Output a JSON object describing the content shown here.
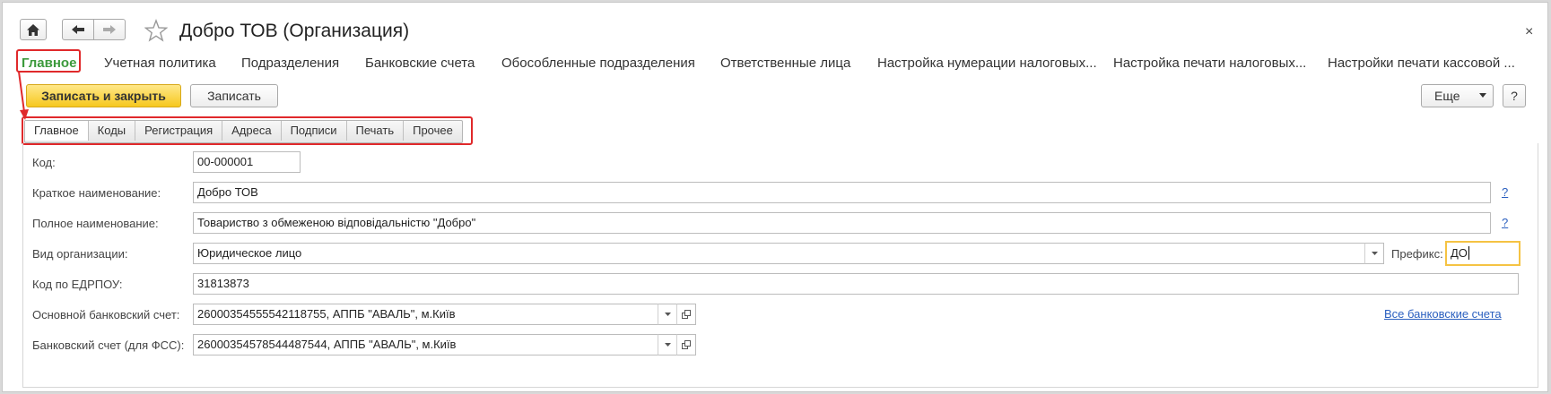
{
  "window": {
    "title": "Добро ТОВ (Организация)",
    "close_glyph": "×"
  },
  "sections": [
    {
      "label": "Главное",
      "active": true
    },
    {
      "label": "Учетная политика"
    },
    {
      "label": "Подразделения"
    },
    {
      "label": "Банковские счета"
    },
    {
      "label": "Обособленные подразделения"
    },
    {
      "label": "Ответственные лица"
    },
    {
      "label": "Настройка нумерации налоговых..."
    },
    {
      "label": "Настройка печати налоговых..."
    },
    {
      "label": "Настройки печати кассовой ..."
    }
  ],
  "toolbar": {
    "save_close_label": "Записать и закрыть",
    "save_label": "Записать",
    "more_label": "Еще",
    "help_label": "?"
  },
  "tabs": [
    {
      "label": "Главное",
      "active": true
    },
    {
      "label": "Коды"
    },
    {
      "label": "Регистрация"
    },
    {
      "label": "Адреса"
    },
    {
      "label": "Подписи"
    },
    {
      "label": "Печать"
    },
    {
      "label": "Прочее"
    }
  ],
  "form": {
    "code": {
      "label": "Код:",
      "value": "00-000001"
    },
    "short_name": {
      "label": "Краткое наименование:",
      "value": "Добро ТОВ",
      "help": "?"
    },
    "full_name": {
      "label": "Полное наименование:",
      "value": "Товариство з обмеженою відповідальністю \"Добро\"",
      "help": "?"
    },
    "org_type": {
      "label": "Вид организации:",
      "value": "Юридическое лицо"
    },
    "prefix": {
      "label": "Префикс:",
      "value": "ДО"
    },
    "edrpou": {
      "label": "Код по ЕДРПОУ:",
      "value": "31813873"
    },
    "main_account": {
      "label": "Основной банковский счет:",
      "value": "26000354555542118755, АППБ \"АВАЛЬ\", м.Київ"
    },
    "fss_account": {
      "label": "Банковский счет (для ФСС):",
      "value": "26000354578544487544, АППБ \"АВАЛЬ\", м.Київ"
    },
    "all_accounts_link": "Все банковские счета"
  },
  "colors": {
    "accent_green": "#3c9a3c",
    "highlight_red": "#e0292b",
    "primary_button": "#f6c81e",
    "focus_border": "#f5c343",
    "link_blue": "#2a5fbf"
  }
}
